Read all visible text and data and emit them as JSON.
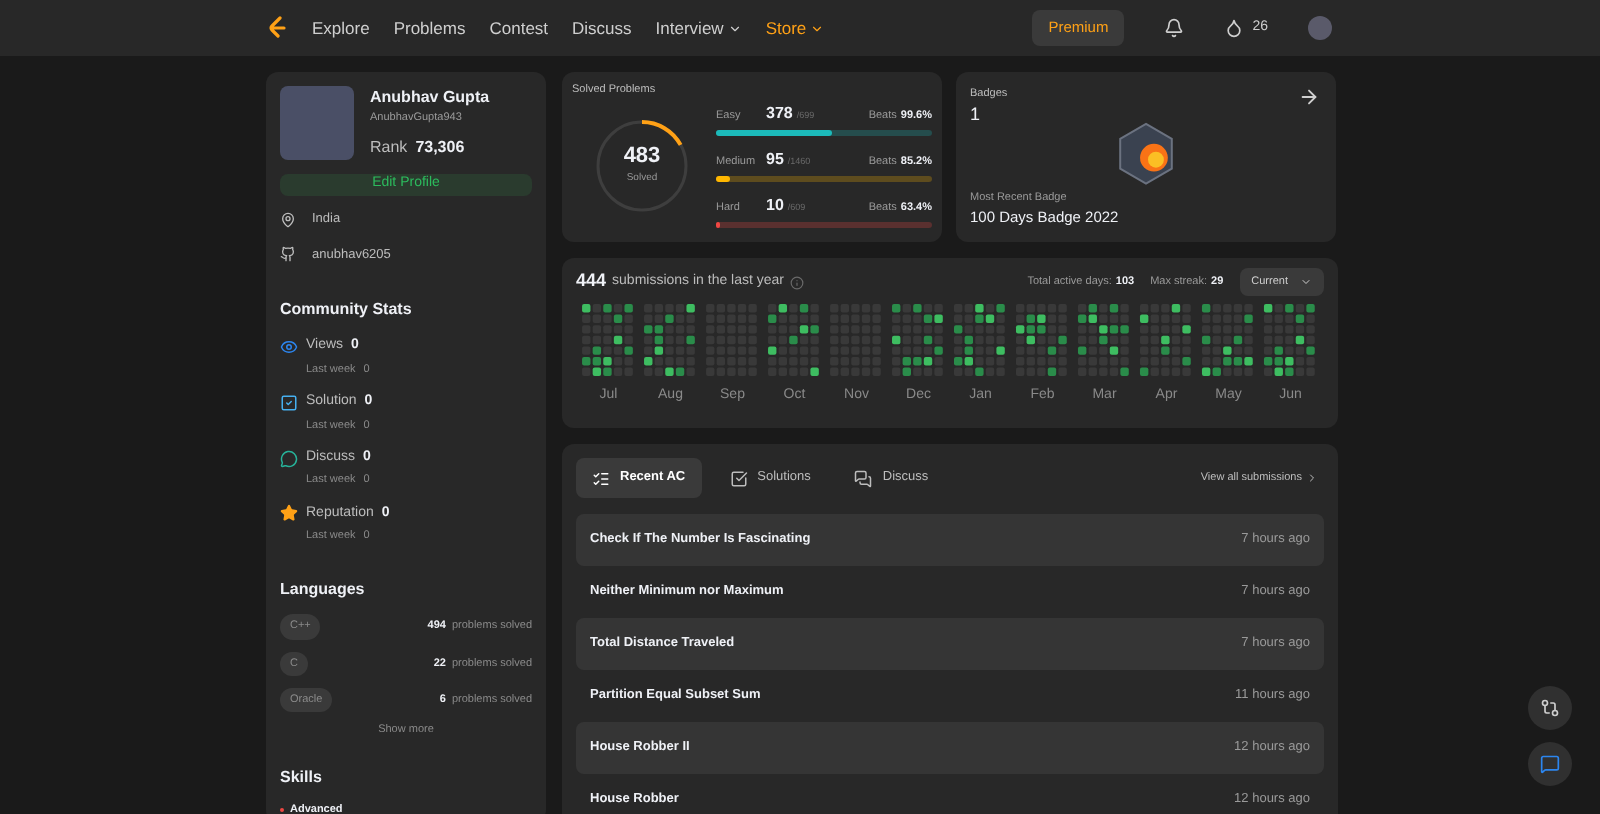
{
  "nav": {
    "items": [
      {
        "label": "Explore",
        "dropdown": false,
        "highlight": false
      },
      {
        "label": "Problems",
        "dropdown": false,
        "highlight": false
      },
      {
        "label": "Contest",
        "dropdown": false,
        "highlight": false
      },
      {
        "label": "Discuss",
        "dropdown": false,
        "highlight": false
      },
      {
        "label": "Interview",
        "dropdown": true,
        "highlight": false
      },
      {
        "label": "Store",
        "dropdown": true,
        "highlight": true
      }
    ],
    "premium": "Premium",
    "streak": "26"
  },
  "profile": {
    "name": "Anubhav Gupta",
    "username": "AnubhavGupta943",
    "rank_label": "Rank",
    "rank": "73,306",
    "edit": "Edit Profile",
    "location": "India",
    "github": "anubhav6205"
  },
  "community": {
    "title": "Community Stats",
    "items": [
      {
        "kind": "views",
        "label": "Views",
        "value": "0",
        "sub": "Last week",
        "sub_value": "0"
      },
      {
        "kind": "solution",
        "label": "Solution",
        "value": "0",
        "sub": "Last week",
        "sub_value": "0"
      },
      {
        "kind": "discuss",
        "label": "Discuss",
        "value": "0",
        "sub": "Last week",
        "sub_value": "0"
      },
      {
        "kind": "reputation",
        "label": "Reputation",
        "value": "0",
        "sub": "Last week",
        "sub_value": "0"
      }
    ]
  },
  "languages": {
    "title": "Languages",
    "items": [
      {
        "name": "C++",
        "count": "494",
        "suffix": "problems solved"
      },
      {
        "name": "C",
        "count": "22",
        "suffix": "problems solved"
      },
      {
        "name": "Oracle",
        "count": "6",
        "suffix": "problems solved"
      }
    ],
    "more": "Show more"
  },
  "skills": {
    "title": "Skills",
    "items": [
      {
        "label": "Advanced",
        "color": "#ef4743"
      }
    ]
  },
  "solved": {
    "title": "Solved Problems",
    "total": "483",
    "total_label": "Solved",
    "level": 0.17,
    "rows": [
      {
        "label": "Easy",
        "count": "378",
        "of": "/699",
        "beats_label": "Beats",
        "beats": "99.6%",
        "color": "#1cbaba",
        "level": 0.54
      },
      {
        "label": "Medium",
        "count": "95",
        "of": "/1460",
        "beats_label": "Beats",
        "beats": "85.2%",
        "color": "#ffb700",
        "level": 0.065
      },
      {
        "label": "Hard",
        "count": "10",
        "of": "/609",
        "beats_label": "Beats",
        "beats": "63.4%",
        "color": "#ef4743",
        "level": 0.016
      }
    ]
  },
  "badges": {
    "title": "Badges",
    "count": "1",
    "recent_label": "Most Recent Badge",
    "recent": "100 Days Badge 2022"
  },
  "calendar": {
    "count": "444",
    "caption": "submissions in the last year",
    "active_label": "Total active days:",
    "active": "103",
    "streak_label": "Max streak:",
    "streak": "29",
    "period": "Current",
    "months": [
      "Jul",
      "Aug",
      "Sep",
      "Oct",
      "Nov",
      "Dec",
      "Jan",
      "Feb",
      "Mar",
      "Apr",
      "May",
      "Jun"
    ]
  },
  "recent": {
    "tabs": [
      {
        "label": "Recent AC",
        "selected": true
      },
      {
        "label": "Solutions",
        "selected": false
      },
      {
        "label": "Discuss",
        "selected": false
      }
    ],
    "view_all": "View all submissions",
    "rows": [
      {
        "title": "Check If The Number Is Fascinating",
        "time": "7 hours ago"
      },
      {
        "title": "Neither Minimum nor Maximum",
        "time": "7 hours ago"
      },
      {
        "title": "Total Distance Traveled",
        "time": "7 hours ago"
      },
      {
        "title": "Partition Equal Subset Sum",
        "time": "11 hours ago"
      },
      {
        "title": "House Robber II",
        "time": "12 hours ago"
      },
      {
        "title": "House Robber",
        "time": "12 hours ago"
      }
    ]
  }
}
